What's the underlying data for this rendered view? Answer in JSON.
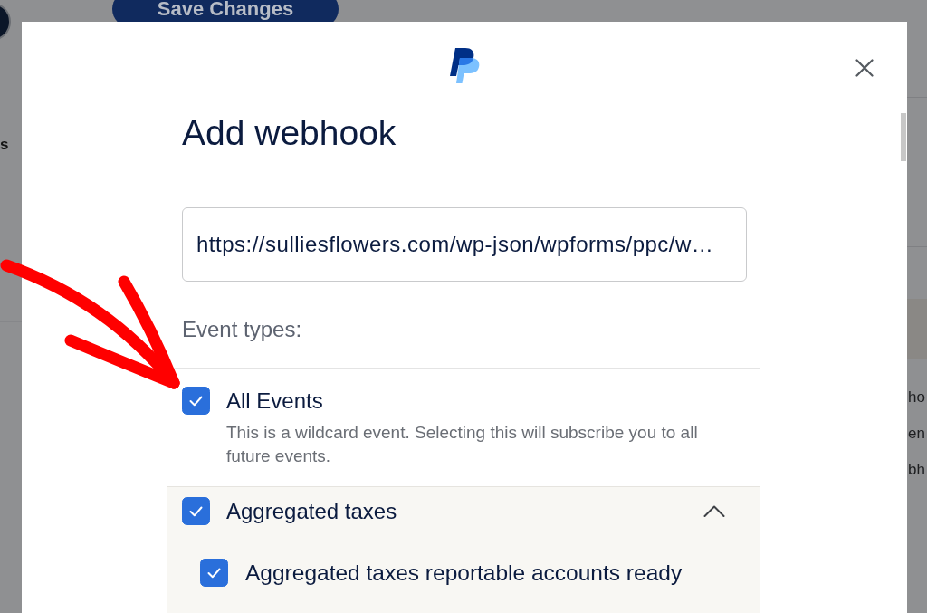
{
  "background": {
    "save_button": "Save Changes",
    "left_text": "s",
    "right_texts": [
      "ho",
      "en",
      "bh"
    ]
  },
  "dialog": {
    "title": "Add webhook",
    "url_field": {
      "value": "https://sulliesflowers.com/wp-json/wpforms/ppc/w…"
    },
    "event_types_label": "Event types:",
    "events": [
      {
        "kind": "wildcard",
        "label": "All Events",
        "checked": true,
        "description": "This is a wildcard event. Selecting this will subscribe you to all future events."
      },
      {
        "kind": "group",
        "label": "Aggregated taxes",
        "checked": true,
        "expanded": true,
        "children": [
          {
            "label": "Aggregated taxes reportable accounts ready",
            "checked": true
          }
        ]
      }
    ]
  }
}
